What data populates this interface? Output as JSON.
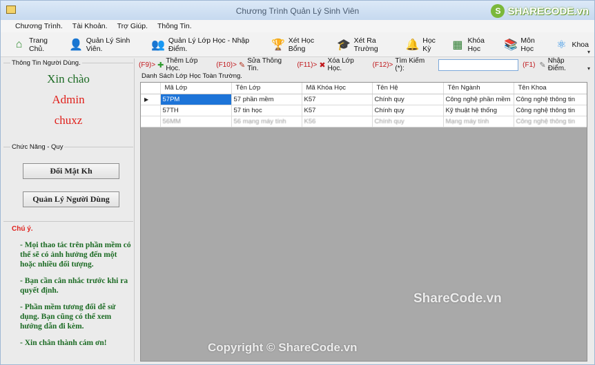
{
  "window": {
    "title": "Chương Trình Quản Lý Sinh Viên"
  },
  "logo": {
    "mark": "S",
    "text": "SHARECODE.vn"
  },
  "menu": [
    "Chương Trình.",
    "Tài Khoản.",
    "Trợ Giúp.",
    "Thông Tin."
  ],
  "toolbar": [
    {
      "label": "Trang Chủ.",
      "icon": "house-icon",
      "glyph": "⌂",
      "color": "#2e8b2e"
    },
    {
      "label": "Quản Lý Sinh Viên.",
      "icon": "student-icon",
      "glyph": "👤",
      "color": "#3b5ea8"
    },
    {
      "label": "Quản Lý Lớp Học - Nhập Điểm.",
      "icon": "group-icon",
      "glyph": "👥",
      "color": "#a06c2e"
    },
    {
      "label": "Xét Học Bổng",
      "icon": "trophy-icon",
      "glyph": "🏆",
      "color": "#d9a400"
    },
    {
      "label": "Xét Ra Trường",
      "icon": "graduation-cap-icon",
      "glyph": "🎓",
      "color": "#222222"
    },
    {
      "label": "Học Kỳ",
      "icon": "bell-icon",
      "glyph": "🔔",
      "color": "#d9a400"
    },
    {
      "label": "Khóa Học",
      "icon": "chalkboard-icon",
      "glyph": "▦",
      "color": "#2e7d32"
    },
    {
      "label": "Môn Học",
      "icon": "books-icon",
      "glyph": "📚",
      "color": "#b5651d"
    },
    {
      "label": "Khoa",
      "icon": "atom-icon",
      "glyph": "⚛",
      "color": "#1e88e5"
    }
  ],
  "left": {
    "user_group_label": "Thông Tin Người Dùng.",
    "greeting": "Xin chào",
    "username": "Admin",
    "role": "chuxz",
    "func_group_label": "Chức Năng - Quy",
    "change_password": "Đổi Mật Kh",
    "manage_users": "Quản Lý Người Dùng",
    "note_title": "Chú ý.",
    "notes": [
      "- Mọi thao tác trên phần mềm có thể sẽ có ảnh hưởng đến một hoặc nhiều đối tượng.",
      "- Bạn cần cân nhắc trước khi ra quyết định.",
      "- Phần mềm tương đối dễ sử dụng. Bạn cũng có thể xem hướng dẫn đi kèm.",
      "- Xin chân thành cám ơn!"
    ]
  },
  "actions": [
    {
      "key": "(F9)>",
      "icon": "add-icon",
      "glyph": "✚",
      "color": "#2e9b2e",
      "label": "Thêm Lớp Học."
    },
    {
      "key": "(F10)>",
      "icon": "edit-icon",
      "glyph": "✎",
      "color": "#b0301a",
      "label": "Sửa Thông Tin."
    },
    {
      "key": "(F11)>",
      "icon": "delete-icon",
      "glyph": "✖",
      "color": "#c0161a",
      "label": "Xóa Lớp Học."
    },
    {
      "key": "(F12)>",
      "icon": "",
      "glyph": "",
      "color": "#000000",
      "label": "Tìm Kiếm (*):"
    }
  ],
  "search": {
    "value": "",
    "key": "(F1)",
    "enter_label": "Nhập Điểm."
  },
  "list_title": "Danh Sách Lớp Học Toàn Trường.",
  "table": {
    "columns": [
      "Mã Lớp",
      "Tên Lớp",
      "Mã Khóa Học",
      "Tên Hệ",
      "Tên Ngành",
      "Tên Khoa"
    ],
    "rows": [
      {
        "marker": "▶",
        "cells": [
          "57PM",
          "57 phần mềm",
          "K57",
          "Chính quy",
          "Công nghệ phần mềm",
          "Công nghệ thông tin"
        ]
      },
      {
        "marker": "",
        "cells": [
          "57TH",
          "57 tin học",
          "K57",
          "Chính quy",
          "Kỹ thuật hệ thống",
          "Công nghệ thông tin"
        ]
      },
      {
        "marker": "",
        "cells": [
          "56MM",
          "56 mạng máy tính",
          "K56",
          "Chính quy",
          "Mạng máy tính",
          "Công nghệ thông tin"
        ]
      }
    ]
  },
  "watermarks": {
    "center": "ShareCode.vn",
    "bottom": "Copyright © ShareCode.vn"
  }
}
